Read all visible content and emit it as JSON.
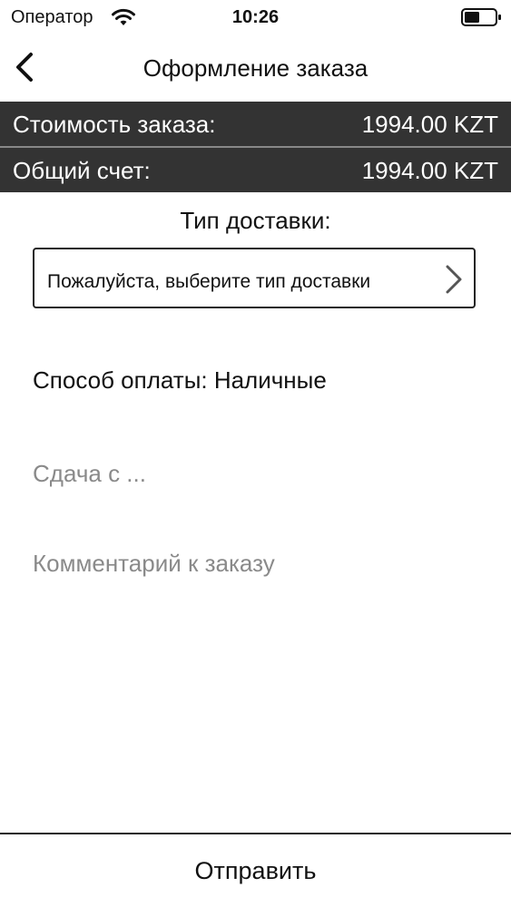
{
  "status_bar": {
    "carrier": "Оператор",
    "wifi_icon": "wifi-icon",
    "time": "10:26",
    "battery_icon": "battery-icon"
  },
  "nav": {
    "back_icon": "chevron-left-icon",
    "title": "Оформление заказа"
  },
  "summary": {
    "order_cost_label": "Стоимость заказа:",
    "order_cost_value": "1994.00 KZT",
    "total_label": "Общий счет:",
    "total_value": "1994.00 KZT",
    "background_color": "#333333"
  },
  "delivery": {
    "label": "Тип доставки:",
    "select_text": "Пожалуйста, выберите тип доставки",
    "chevron_icon": "chevron-right-icon"
  },
  "payment": {
    "text": "Способ оплаты: Наличные"
  },
  "change": {
    "value": "",
    "placeholder": "Сдача с ..."
  },
  "comment": {
    "value": "",
    "placeholder": "Комментарий к заказу"
  },
  "footer": {
    "submit_label": "Отправить"
  }
}
